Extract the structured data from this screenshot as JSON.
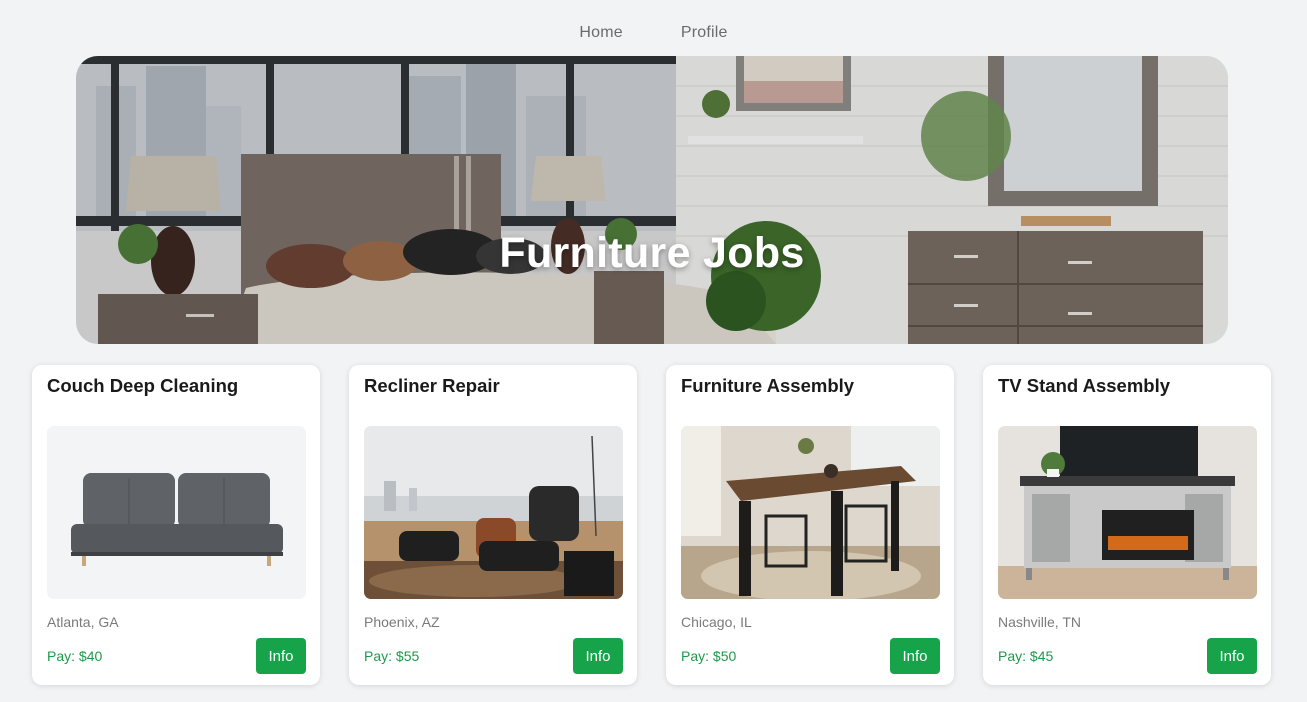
{
  "nav": {
    "home_label": "Home",
    "profile_label": "Profile"
  },
  "hero": {
    "title": "Furniture Jobs"
  },
  "colors": {
    "accent": "#17a34a",
    "pay_text": "#1e9a4a",
    "background": "#f2f3f5"
  },
  "jobs": [
    {
      "title": "Couch Deep Cleaning",
      "location": "Atlanta, GA",
      "pay": "Pay: $40",
      "button": "Info",
      "image": "sofa-image"
    },
    {
      "title": "Recliner Repair",
      "location": "Phoenix, AZ",
      "pay": "Pay: $55",
      "button": "Info",
      "image": "recliner-image"
    },
    {
      "title": "Furniture Assembly",
      "location": "Chicago, IL",
      "pay": "Pay: $50",
      "button": "Info",
      "image": "dining-table-image"
    },
    {
      "title": "TV Stand Assembly",
      "location": "Nashville, TN",
      "pay": "Pay: $45",
      "button": "Info",
      "image": "tv-stand-image"
    }
  ]
}
